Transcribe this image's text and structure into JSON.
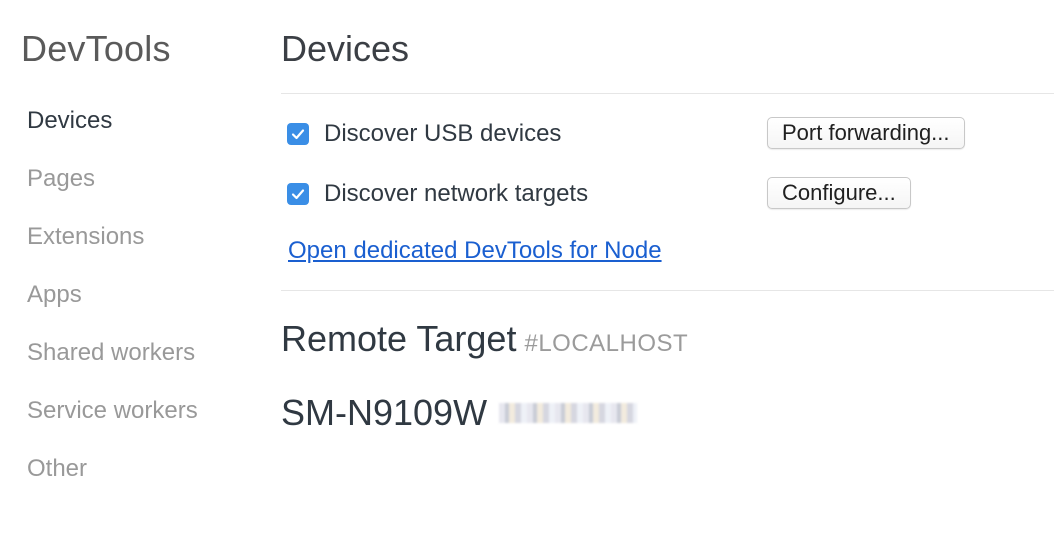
{
  "sidebar": {
    "app_title": "DevTools",
    "items": [
      {
        "label": "Devices",
        "active": true
      },
      {
        "label": "Pages",
        "active": false
      },
      {
        "label": "Extensions",
        "active": false
      },
      {
        "label": "Apps",
        "active": false
      },
      {
        "label": "Shared workers",
        "active": false
      },
      {
        "label": "Service workers",
        "active": false
      },
      {
        "label": "Other",
        "active": false
      }
    ]
  },
  "main": {
    "title": "Devices",
    "options": [
      {
        "label": "Discover USB devices",
        "checked": true,
        "button_label": "Port forwarding..."
      },
      {
        "label": "Discover network targets",
        "checked": true,
        "button_label": "Configure..."
      }
    ],
    "node_link": "Open dedicated DevTools for Node",
    "remote_target": {
      "title": "Remote Target",
      "subtitle": "#LOCALHOST"
    },
    "device": {
      "name": "SM-N9109W"
    }
  },
  "colors": {
    "accent": "#3a8ee6",
    "link": "#1a5fd0",
    "muted_text": "#999999"
  }
}
